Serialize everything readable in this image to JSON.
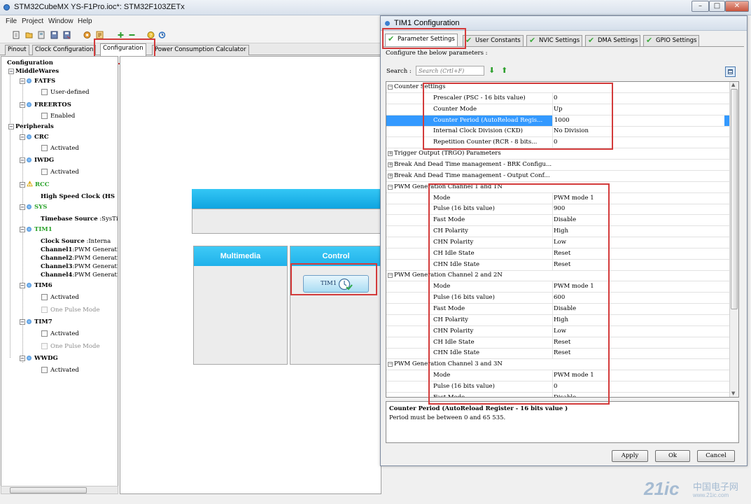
{
  "window": {
    "title": "STM32CubeMX YS-F1Pro.ioc*: STM32F103ZETx",
    "controls": [
      "–",
      "□",
      "✕"
    ]
  },
  "menu": [
    "File",
    "Project",
    "Window",
    "Help"
  ],
  "toolbar_icons": [
    "new-project-icon",
    "open-icon",
    "open-example-icon",
    "save-icon",
    "save-as-icon",
    "generate-code-icon",
    "generate-report-icon",
    "zoom-in-icon",
    "zoom-out-icon",
    "help-icon",
    "update-icon"
  ],
  "main_tabs": [
    "Pinout",
    "Clock Configuration",
    "Configuration",
    "Power Consumption Calculator"
  ],
  "tree": {
    "root": "Configuration",
    "middlewares": "MiddleWares",
    "fatfs": "FATFS",
    "user_defined": "User-defined",
    "freertos": "FREERTOS",
    "enabled": "Enabled",
    "peripherals": "Peripherals",
    "crc": "CRC",
    "activated": "Activated",
    "iwdg": "IWDG",
    "rcc": "RCC",
    "hsc_label": "High Speed Clock (HS",
    "sys": "SYS",
    "timebase_label": "Timebase Source",
    "timebase_value": ":SysTi",
    "tim1": "TIM1",
    "clock_source_label": "Clock Source",
    "clock_source_value": ":Interna",
    "ch1_label": "Channel1",
    "ch2_label": "Channel2",
    "ch3_label": "Channel3",
    "ch4_label": "Channel4",
    "ch_value": ":PWM Generatic",
    "tim6": "TIM6",
    "one_pulse": "One Pulse Mode",
    "tim7": "TIM7",
    "wwdg": "WWDG"
  },
  "canvas": {
    "multimedia": "Multimedia",
    "control": "Control",
    "tim1_button": "TIM1"
  },
  "dialog": {
    "title": "TIM1 Configuration",
    "tabs": [
      "Parameter Settings",
      "User Constants",
      "NVIC Settings",
      "DMA Settings",
      "GPIO Settings"
    ],
    "configure_label": "Configure the below parameters :",
    "search_label": "Search :",
    "search_placeholder": "Search (Crtl+F)",
    "sections": {
      "counter": "Counter Settings",
      "trigger": "Trigger Output (TRGO) Parameters",
      "brk": "Break And Dead Time management - BRK Configu...",
      "output": "Break And Dead Time management - Output Conf...",
      "ch1": "PWM Generation Channel 1 and 1N",
      "ch2": "PWM Generation Channel 2 and 2N",
      "ch3": "PWM Generation Channel 3 and 3N"
    },
    "counter_rows": [
      {
        "k": "Prescaler (PSC - 16 bits value)",
        "v": "0"
      },
      {
        "k": "Counter Mode",
        "v": "Up"
      },
      {
        "k": "Counter Period (AutoReload Regis...",
        "v": "1000"
      },
      {
        "k": "Internal Clock Division (CKD)",
        "v": "No Division"
      },
      {
        "k": "Repetition Counter (RCR - 8 bits...",
        "v": "0"
      }
    ],
    "ch1_rows": [
      {
        "k": "Mode",
        "v": "PWM mode 1"
      },
      {
        "k": "Pulse (16 bits value)",
        "v": "900"
      },
      {
        "k": "Fast Mode",
        "v": "Disable"
      },
      {
        "k": "CH Polarity",
        "v": "High"
      },
      {
        "k": "CHN Polarity",
        "v": "Low"
      },
      {
        "k": "CH Idle State",
        "v": "Reset"
      },
      {
        "k": "CHN Idle State",
        "v": "Reset"
      }
    ],
    "ch2_rows": [
      {
        "k": "Mode",
        "v": "PWM mode 1"
      },
      {
        "k": "Pulse (16 bits value)",
        "v": "600"
      },
      {
        "k": "Fast Mode",
        "v": "Disable"
      },
      {
        "k": "CH Polarity",
        "v": "High"
      },
      {
        "k": "CHN Polarity",
        "v": "Low"
      },
      {
        "k": "CH Idle State",
        "v": "Reset"
      },
      {
        "k": "CHN Idle State",
        "v": "Reset"
      }
    ],
    "ch3_rows": [
      {
        "k": "Mode",
        "v": "PWM mode 1"
      },
      {
        "k": "Pulse (16 bits value)",
        "v": "0"
      },
      {
        "k": "Fast Mode",
        "v": "Disable"
      }
    ],
    "desc_title": "Counter Period (AutoReload Register - 16 bits value )",
    "desc_text": "Period must be between 0 and 65 535.",
    "buttons": {
      "apply": "Apply",
      "ok": "Ok",
      "cancel": "Cancel"
    }
  },
  "watermark": {
    "logo": "21ic",
    "cn": "中国电子网",
    "url": "www.21ic.com"
  },
  "colors": {
    "accent_cyan": "#1fb1ea",
    "highlight": "#3399ff",
    "annotation_red": "#d33b3b",
    "tree_green": "#2aa22a"
  }
}
